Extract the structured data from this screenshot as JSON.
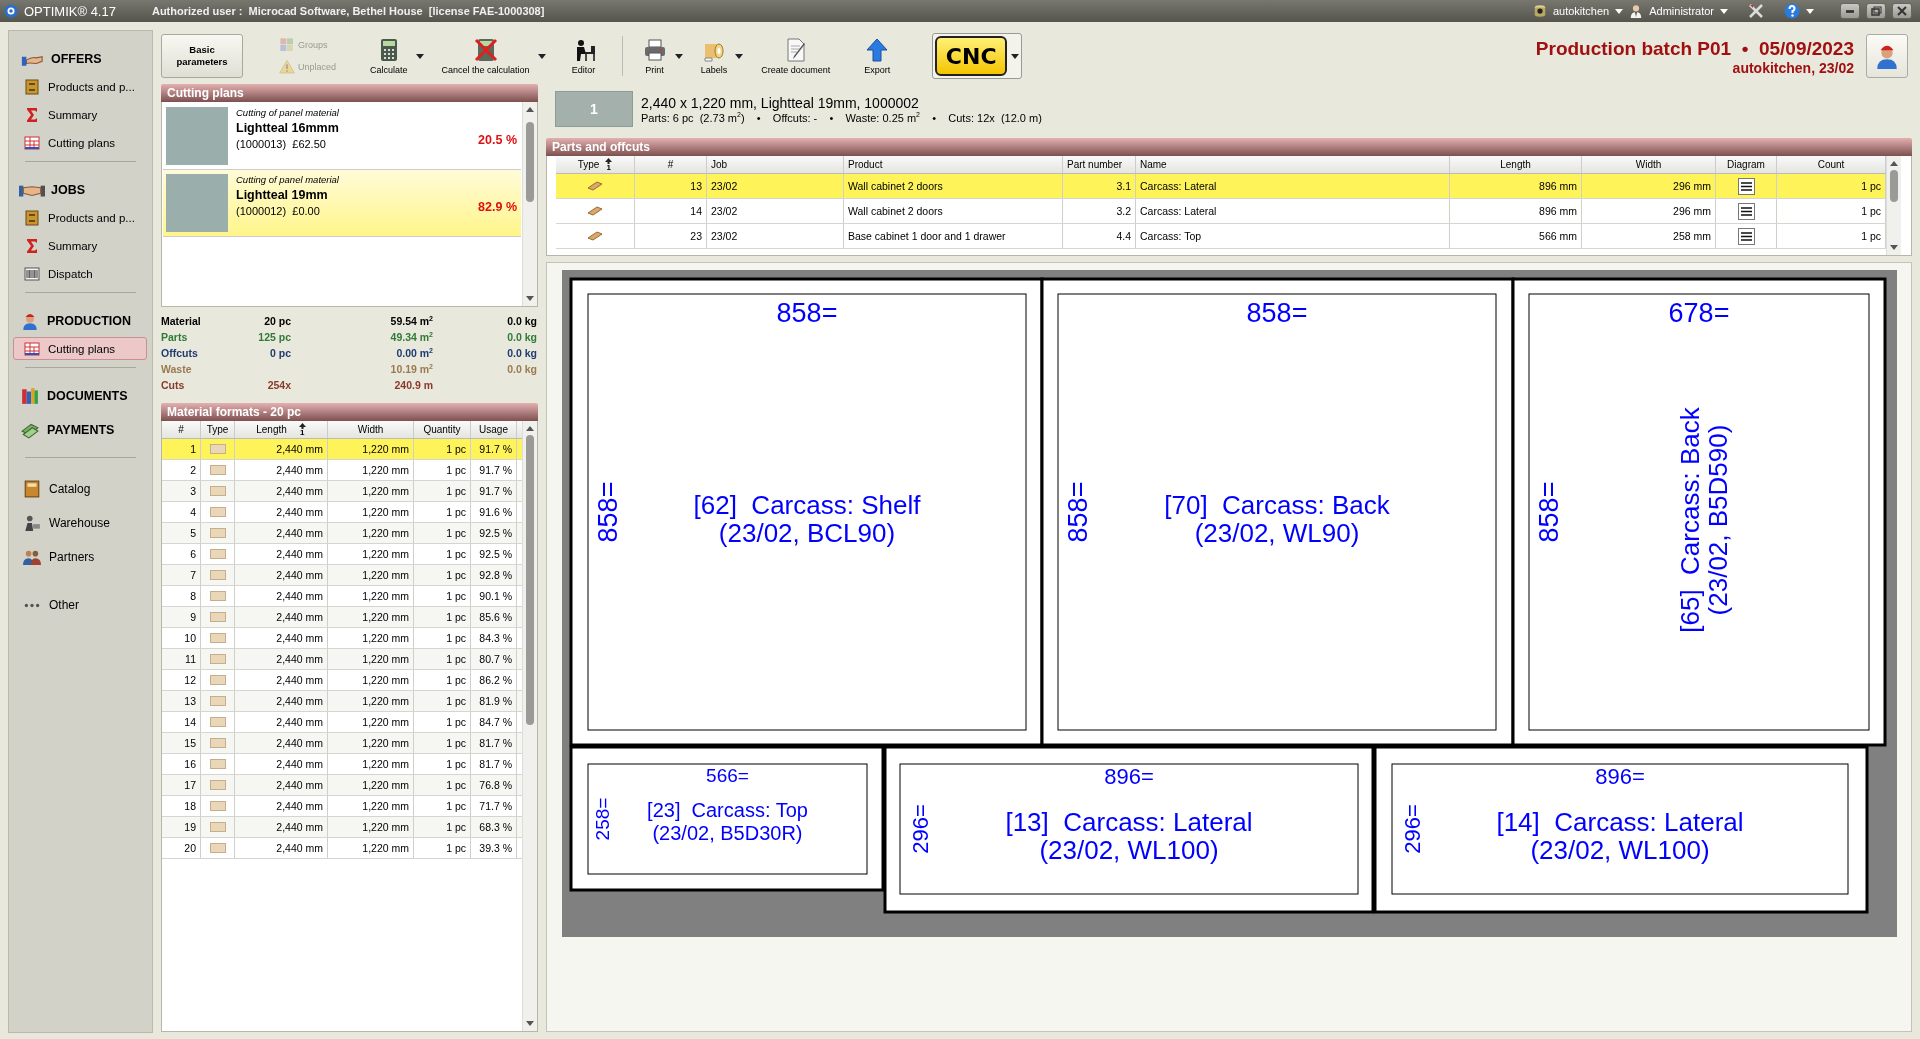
{
  "app": {
    "title": "OPTIMIK® 4.17",
    "authorized_user": "Authorized user :  Microcad Software, Bethel House  [license FAE-1000308]",
    "database": "autokitchen",
    "user": "Administrator"
  },
  "sidebar": {
    "groups": [
      {
        "title": "OFFERS",
        "items": [
          {
            "label": "Products and p...",
            "selected": false
          },
          {
            "label": "Summary",
            "selected": false
          },
          {
            "label": "Cutting plans",
            "selected": false
          }
        ]
      },
      {
        "title": "JOBS",
        "items": [
          {
            "label": "Products and p...",
            "selected": false
          },
          {
            "label": "Summary",
            "selected": false
          },
          {
            "label": "Dispatch",
            "selected": false
          }
        ]
      },
      {
        "title": "PRODUCTION",
        "items": [
          {
            "label": "Cutting plans",
            "selected": true
          }
        ]
      },
      {
        "title": "DOCUMENTS"
      },
      {
        "title": "PAYMENTS"
      }
    ],
    "links": [
      "Catalog",
      "Warehouse",
      "Partners",
      "Other"
    ]
  },
  "toolbar": {
    "buttons": [
      {
        "kind": "boxed",
        "label": "Basic parameters",
        "disabled": false,
        "dropdown": false
      },
      {
        "kind": "small",
        "label": "Groups",
        "disabled": true,
        "dropdown": false
      },
      {
        "kind": "small",
        "label": "Unplaced",
        "disabled": true,
        "dropdown": false
      },
      {
        "kind": "large",
        "label": "Calculate",
        "disabled": false,
        "dropdown": true
      },
      {
        "kind": "large",
        "label": "Cancel the calculation",
        "disabled": false,
        "dropdown": true
      },
      {
        "kind": "large",
        "label": "Editor",
        "disabled": false,
        "dropdown": false
      },
      {
        "kind": "large",
        "label": "Print",
        "disabled": false,
        "dropdown": true
      },
      {
        "kind": "large",
        "label": "Labels",
        "disabled": false,
        "dropdown": true
      },
      {
        "kind": "large",
        "label": "Create document",
        "disabled": false,
        "dropdown": false
      },
      {
        "kind": "large",
        "label": "Export",
        "disabled": false,
        "dropdown": false
      },
      {
        "kind": "cnc",
        "label": "CNC",
        "disabled": false,
        "dropdown": true
      }
    ]
  },
  "header": {
    "title": "Production batch P01  •  05/09/2023",
    "subtitle": "autokitchen, 23/02"
  },
  "cutting_plans": {
    "title": "Cutting plans",
    "items": [
      {
        "caption": "Cutting of panel material",
        "name": "Lightteal 16mmm",
        "code": "(1000013)  £62.50",
        "usage": "20.5 %",
        "selected": false
      },
      {
        "caption": "Cutting of panel material",
        "name": "Lightteal 19mm",
        "code": "(1000012)  £0.00",
        "usage": "82.9 %",
        "selected": true
      }
    ]
  },
  "totals": [
    {
      "kind": "material",
      "label": "Material",
      "count": "20 pc",
      "area": "59.54 m$^{2}$",
      "weight": "0.0 kg"
    },
    {
      "kind": "parts",
      "label": "Parts",
      "count": "125 pc",
      "area": "49.34 m$^{2}$",
      "weight": "0.0 kg"
    },
    {
      "kind": "offcuts",
      "label": "Offcuts",
      "count": "0 pc",
      "area": "0.00 m$^{2}$",
      "weight": "0.0 kg"
    },
    {
      "kind": "waste",
      "label": "Waste",
      "area": "10.19 m$^{2}$",
      "weight": "0.0 kg"
    },
    {
      "kind": "cuts",
      "label": "Cuts",
      "count": "254x",
      "area": "240.9 m"
    }
  ],
  "material_formats": {
    "title": "Material formats - 20 pc",
    "columns": [
      {
        "label": "#"
      },
      {
        "label": "Type"
      },
      {
        "label": "Length",
        "sort": "1"
      },
      {
        "label": "Width"
      },
      {
        "label": "Quantity"
      },
      {
        "label": "Usage"
      }
    ],
    "rows": [
      {
        "number": "1",
        "length": "2,440 mm",
        "width": "1,220 mm",
        "quantity": "1 pc",
        "usage": "91.7 %",
        "selected": true
      },
      {
        "number": "2",
        "length": "2,440 mm",
        "width": "1,220 mm",
        "quantity": "1 pc",
        "usage": "91.7 %",
        "selected": false
      },
      {
        "number": "3",
        "length": "2,440 mm",
        "width": "1,220 mm",
        "quantity": "1 pc",
        "usage": "91.7 %",
        "selected": false
      },
      {
        "number": "4",
        "length": "2,440 mm",
        "width": "1,220 mm",
        "quantity": "1 pc",
        "usage": "91.6 %",
        "selected": false
      },
      {
        "number": "5",
        "length": "2,440 mm",
        "width": "1,220 mm",
        "quantity": "1 pc",
        "usage": "92.5 %",
        "selected": false
      },
      {
        "number": "6",
        "length": "2,440 mm",
        "width": "1,220 mm",
        "quantity": "1 pc",
        "usage": "92.5 %",
        "selected": false
      },
      {
        "number": "7",
        "length": "2,440 mm",
        "width": "1,220 mm",
        "quantity": "1 pc",
        "usage": "92.8 %",
        "selected": false
      },
      {
        "number": "8",
        "length": "2,440 mm",
        "width": "1,220 mm",
        "quantity": "1 pc",
        "usage": "90.1 %",
        "selected": false
      },
      {
        "number": "9",
        "length": "2,440 mm",
        "width": "1,220 mm",
        "quantity": "1 pc",
        "usage": "85.6 %",
        "selected": false
      },
      {
        "number": "10",
        "length": "2,440 mm",
        "width": "1,220 mm",
        "quantity": "1 pc",
        "usage": "84.3 %",
        "selected": false
      },
      {
        "number": "11",
        "length": "2,440 mm",
        "width": "1,220 mm",
        "quantity": "1 pc",
        "usage": "80.7 %",
        "selected": false
      },
      {
        "number": "12",
        "length": "2,440 mm",
        "width": "1,220 mm",
        "quantity": "1 pc",
        "usage": "86.2 %",
        "selected": false
      },
      {
        "number": "13",
        "length": "2,440 mm",
        "width": "1,220 mm",
        "quantity": "1 pc",
        "usage": "81.9 %",
        "selected": false
      },
      {
        "number": "14",
        "length": "2,440 mm",
        "width": "1,220 mm",
        "quantity": "1 pc",
        "usage": "84.7 %",
        "selected": false
      },
      {
        "number": "15",
        "length": "2,440 mm",
        "width": "1,220 mm",
        "quantity": "1 pc",
        "usage": "81.7 %",
        "selected": false
      },
      {
        "number": "16",
        "length": "2,440 mm",
        "width": "1,220 mm",
        "quantity": "1 pc",
        "usage": "81.7 %",
        "selected": false
      },
      {
        "number": "17",
        "length": "2,440 mm",
        "width": "1,220 mm",
        "quantity": "1 pc",
        "usage": "76.8 %",
        "selected": false
      },
      {
        "number": "18",
        "length": "2,440 mm",
        "width": "1,220 mm",
        "quantity": "1 pc",
        "usage": "71.7 %",
        "selected": false
      },
      {
        "number": "19",
        "length": "2,440 mm",
        "width": "1,220 mm",
        "quantity": "1 pc",
        "usage": "68.3 %",
        "selected": false
      },
      {
        "number": "20",
        "length": "2,440 mm",
        "width": "1,220 mm",
        "quantity": "1 pc",
        "usage": "39.3 %",
        "selected": false
      }
    ]
  },
  "sheet": {
    "number": "1",
    "title": "2,440 x 1,220 mm, Lightteal 19mm, 1000002",
    "stats": "Parts: 6 pc  (2.73 m$^{2}$)    •    Offcuts: -    •    Waste: 0.25 m$^{2}$    •    Cuts: 12x  (12.0 m)"
  },
  "parts": {
    "title": "Parts and offcuts",
    "columns": [
      {
        "label": "Type",
        "sort": "1"
      },
      {
        "label": "#"
      },
      {
        "label": "Job"
      },
      {
        "label": "Product"
      },
      {
        "label": "Part number"
      },
      {
        "label": "Name"
      },
      {
        "label": "Length"
      },
      {
        "label": "Width"
      },
      {
        "label": "Diagram"
      },
      {
        "label": "Count"
      }
    ],
    "rows": [
      {
        "number": "13",
        "job": "23/02",
        "product": "Wall cabinet 2 doors",
        "part_number": "3.1",
        "name": "Carcass: Lateral",
        "length": "896 mm",
        "width": "296 mm",
        "count": "1 pc",
        "selected": true
      },
      {
        "number": "14",
        "job": "23/02",
        "product": "Wall cabinet 2 doors",
        "part_number": "3.2",
        "name": "Carcass: Lateral",
        "length": "896 mm",
        "width": "296 mm",
        "count": "1 pc",
        "selected": false
      },
      {
        "number": "23",
        "job": "23/02",
        "product": "Base cabinet 1 door and 1 drawer",
        "part_number": "4.4",
        "name": "Carcass: Top",
        "length": "566 mm",
        "width": "258 mm",
        "count": "1 pc",
        "selected": false
      }
    ]
  },
  "diagram": {
    "pieces": [
      {
        "label": "[62]  Carcass: Shelf",
        "detail": "(23/02, BCL90)",
        "length": "858=",
        "width": "858="
      },
      {
        "label": "[70]  Carcass: Back",
        "detail": "(23/02, WL90)",
        "length": "858=",
        "width": "858="
      },
      {
        "label": "[65]  Carcass: Back",
        "detail": "(23/02, B5D590)",
        "length": "678=",
        "width": "858="
      },
      {
        "label": "[23]  Carcass: Top",
        "detail": "(23/02, B5D30R)",
        "length": "566=",
        "width": "258="
      },
      {
        "label": "[13]  Carcass: Lateral",
        "detail": "(23/02, WL100)",
        "length": "896=",
        "width": "296="
      },
      {
        "label": "[14]  Carcass: Lateral",
        "detail": "(23/02, WL100)",
        "length": "896=",
        "width": "296="
      }
    ]
  }
}
